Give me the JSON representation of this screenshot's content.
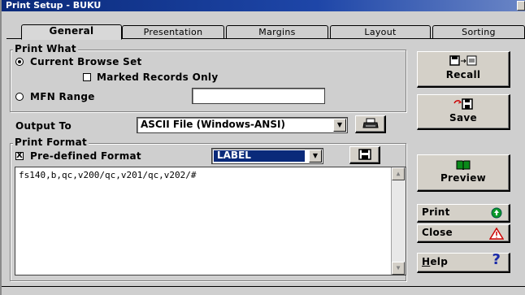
{
  "window": {
    "title": "Print Setup - BUKU"
  },
  "tabs": [
    {
      "label": "General",
      "active": true
    },
    {
      "label": "Presentation",
      "active": false
    },
    {
      "label": "Margins",
      "active": false
    },
    {
      "label": "Layout",
      "active": false
    },
    {
      "label": "Sorting",
      "active": false
    }
  ],
  "print_what": {
    "legend": "Print What",
    "current_browse_set": {
      "label": "Current Browse Set",
      "selected": true
    },
    "marked_records_only": {
      "label": "Marked Records Only",
      "checked": false
    },
    "mfn_range": {
      "label": "MFN Range",
      "selected": false,
      "value": ""
    }
  },
  "output_to": {
    "label": "Output To",
    "value": "ASCII File (Windows-ANSI)"
  },
  "print_format": {
    "legend": "Print Format",
    "predefined": {
      "label": "Pre-defined Format",
      "checked": true,
      "check_mark": "X"
    },
    "format_value": "LABEL",
    "format_text": "fs140,b,qc,v200/qc,v201/qc,v202/#"
  },
  "buttons": {
    "recall": "Recall",
    "save": "Save",
    "preview": "Preview",
    "print": "Print",
    "close": "Close",
    "help": "Help",
    "help_mnemonic": "H",
    "help_rest": "elp",
    "help_glyph": "?"
  },
  "colors": {
    "title_bar": "#0a2a7a",
    "print_icon": "#0a9a28",
    "close_icon": "#cc0000",
    "help_icon": "#1a2aa8"
  }
}
